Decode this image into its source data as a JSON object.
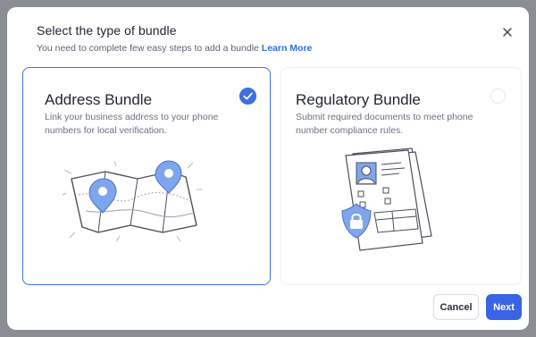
{
  "dialog": {
    "title": "Select the type of bundle",
    "subtitle": "You need to complete few easy steps to add a bundle",
    "learn_more": "Learn More",
    "close_icon": "close-icon"
  },
  "options": [
    {
      "title": "Address Bundle",
      "description": "Link your business address to your phone numbers for local verification.",
      "selected": true,
      "icon": "map-pins-illustration"
    },
    {
      "title": "Regulatory Bundle",
      "description": "Submit required documents to meet phone number compliance rules.",
      "selected": false,
      "icon": "document-lock-illustration"
    }
  ],
  "footer": {
    "cancel_label": "Cancel",
    "next_label": "Next"
  },
  "colors": {
    "accent": "#3b63e6",
    "link": "#2f6fe4",
    "selected_border": "#3f6fe0",
    "backdrop": "#8a8d93"
  }
}
